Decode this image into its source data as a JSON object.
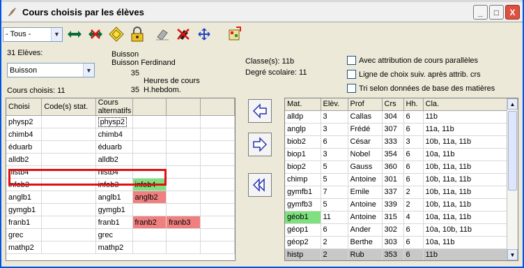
{
  "window": {
    "title": "Cours choisis par les élèves",
    "minimize": "_",
    "maximize": "□",
    "close": "X"
  },
  "toolbar": {
    "filter_value": "- Tous -",
    "icons": [
      "swap-arrows-icon",
      "scissors-arrows-icon",
      "diamond-icon",
      "lock-icon",
      "eraser-icon",
      "delete-eraser-icon",
      "expand-icon",
      "puzzle-icon"
    ]
  },
  "left": {
    "students_count": "31 Elèves:",
    "student_select": "Buisson",
    "student_name1": "Buisson",
    "student_name2": "Buisson Ferdinand",
    "hours_num": "35",
    "hours_label": "Heures de cours",
    "hebdom_num": "35",
    "hebdom_label": "H.hebdom.",
    "chosen_label": "Cours choisis: 11",
    "columns": [
      "Choisi",
      "Code(s) stat.",
      "Cours alternatifs",
      "",
      "",
      ""
    ],
    "rows": [
      {
        "choisi": "physp2",
        "code": "",
        "alts": [
          "physp2",
          "",
          "",
          ""
        ],
        "alt_colors": [
          "",
          "",
          "",
          ""
        ]
      },
      {
        "choisi": "chimb4",
        "code": "",
        "alts": [
          "chimb4",
          "",
          "",
          ""
        ],
        "alt_colors": [
          "",
          "",
          "",
          ""
        ]
      },
      {
        "choisi": "éduarb",
        "code": "",
        "alts": [
          "éduarb",
          "",
          "",
          ""
        ],
        "alt_colors": [
          "",
          "",
          "",
          ""
        ]
      },
      {
        "choisi": "alldb2",
        "code": "",
        "alts": [
          "alldb2",
          "",
          "",
          ""
        ],
        "alt_colors": [
          "",
          "",
          "",
          ""
        ]
      },
      {
        "choisi": "histb4",
        "code": "",
        "alts": [
          "histb4",
          "",
          "",
          ""
        ],
        "alt_colors": [
          "",
          "",
          "",
          ""
        ]
      },
      {
        "choisi": "infob3",
        "code": "",
        "alts": [
          "infob3",
          "infob4",
          "",
          ""
        ],
        "alt_colors": [
          "",
          "green",
          "",
          ""
        ]
      },
      {
        "choisi": "anglb1",
        "code": "",
        "alts": [
          "anglb1",
          "anglb2",
          "",
          ""
        ],
        "alt_colors": [
          "",
          "red",
          "",
          ""
        ]
      },
      {
        "choisi": "gymgb1",
        "code": "",
        "alts": [
          "gymgb1",
          "",
          "",
          ""
        ],
        "alt_colors": [
          "",
          "",
          "",
          ""
        ]
      },
      {
        "choisi": "franb1",
        "code": "",
        "alts": [
          "franb1",
          "franb2",
          "franb3",
          ""
        ],
        "alt_colors": [
          "",
          "red",
          "red",
          ""
        ]
      },
      {
        "choisi": "grec",
        "code": "",
        "alts": [
          "grec",
          "",
          "",
          ""
        ],
        "alt_colors": [
          "",
          "",
          "",
          ""
        ]
      },
      {
        "choisi": "mathp2",
        "code": "",
        "alts": [
          "mathp2",
          "",
          "",
          ""
        ],
        "alt_colors": [
          "",
          "",
          "",
          ""
        ]
      }
    ]
  },
  "right": {
    "class_label": "Classe(s): 11b",
    "degree_label": "Degré scolaire: 11",
    "check1": "Avec attribution de cours parallèles",
    "check2": "Ligne de choix suiv. après attrib. crs",
    "check3": "Tri selon données de base des matières",
    "columns": [
      "Mat.",
      "Elèv.",
      "Prof",
      "Crs",
      "Hh.",
      "Cla."
    ],
    "rows": [
      {
        "mat": "alldp",
        "elev": "3",
        "prof": "Callas",
        "crs": "304",
        "hh": "6",
        "cla": "11b",
        "color": ""
      },
      {
        "mat": "anglp",
        "elev": "3",
        "prof": "Frédé",
        "crs": "307",
        "hh": "6",
        "cla": "11a, 11b",
        "color": ""
      },
      {
        "mat": "biob2",
        "elev": "6",
        "prof": "César",
        "crs": "333",
        "hh": "3",
        "cla": "10b, 11a, 11b",
        "color": ""
      },
      {
        "mat": "biop1",
        "elev": "3",
        "prof": "Nobel",
        "crs": "354",
        "hh": "6",
        "cla": "10a, 11b",
        "color": ""
      },
      {
        "mat": "biop2",
        "elev": "5",
        "prof": "Gauss",
        "crs": "360",
        "hh": "6",
        "cla": "10b, 11a, 11b",
        "color": ""
      },
      {
        "mat": "chimp",
        "elev": "5",
        "prof": "Antoine",
        "crs": "301",
        "hh": "6",
        "cla": "10b, 11a, 11b",
        "color": ""
      },
      {
        "mat": "gymfb1",
        "elev": "7",
        "prof": "Emile",
        "crs": "337",
        "hh": "2",
        "cla": "10b, 11a, 11b",
        "color": ""
      },
      {
        "mat": "gymfb3",
        "elev": "5",
        "prof": "Antoine",
        "crs": "339",
        "hh": "2",
        "cla": "10b, 11a, 11b",
        "color": ""
      },
      {
        "mat": "géob1",
        "elev": "11",
        "prof": "Antoine",
        "crs": "315",
        "hh": "4",
        "cla": "10a, 11a, 11b",
        "color": "green"
      },
      {
        "mat": "géop1",
        "elev": "6",
        "prof": "Ander",
        "crs": "302",
        "hh": "6",
        "cla": "10a, 10b, 11b",
        "color": ""
      },
      {
        "mat": "géop2",
        "elev": "2",
        "prof": "Berthe",
        "crs": "303",
        "hh": "6",
        "cla": "10a, 11b",
        "color": ""
      },
      {
        "mat": "histp",
        "elev": "2",
        "prof": "Rub",
        "crs": "353",
        "hh": "6",
        "cla": "11b",
        "color": "selected"
      }
    ]
  }
}
